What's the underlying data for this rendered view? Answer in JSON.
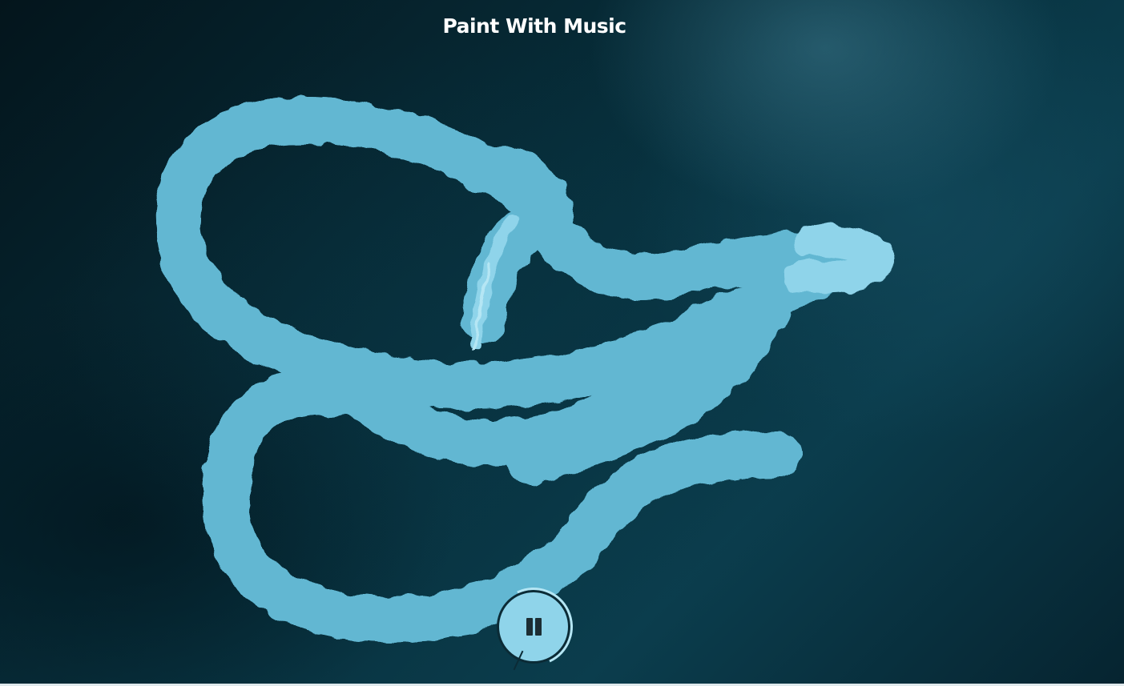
{
  "app": {
    "title": "Paint With Music"
  },
  "colors": {
    "stroke": "#8fd4ea",
    "stroke_light": "#b5e6f4",
    "stroke_dark": "#63b8d3",
    "background": "#031a22",
    "icon": "#1c2d33"
  },
  "controls": {
    "playback_icon": "pause-icon",
    "playing": true
  }
}
